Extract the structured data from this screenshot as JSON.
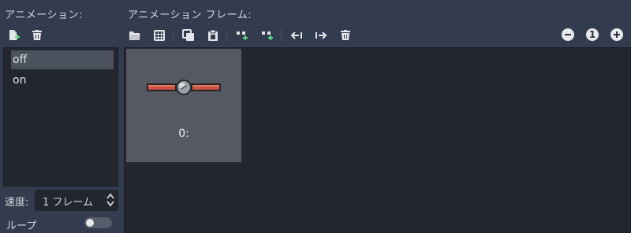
{
  "left_panel": {
    "heading": "アニメーション:",
    "animations": [
      {
        "label": "off",
        "selected": true
      },
      {
        "label": "on",
        "selected": false
      }
    ],
    "speed_label": "速度:",
    "speed_value": "1 フレーム",
    "loop_label": "ループ",
    "loop_enabled": false
  },
  "frames_panel": {
    "heading": "アニメーション フレーム:",
    "frames": [
      {
        "label": "0:"
      }
    ],
    "zoom_reset_label": "1"
  },
  "colors": {
    "background": "#333b4f",
    "list_background": "#21262f",
    "selected_item": "#4b515d",
    "frame_card": "#545963",
    "accent_green": "#5fd884"
  }
}
